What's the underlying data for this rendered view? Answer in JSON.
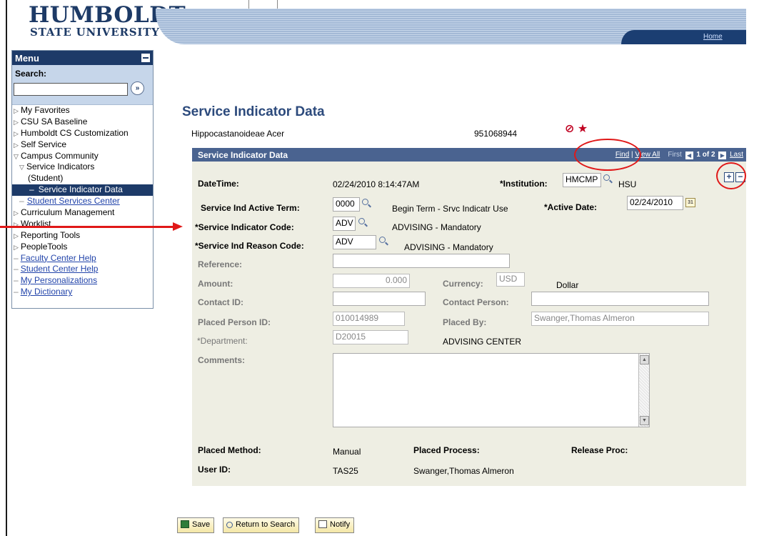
{
  "header": {
    "logo_line1": "HUMBOLDT",
    "logo_line2": "STATE UNIVERSITY",
    "home_link": "Home"
  },
  "sidebar": {
    "title": "Menu",
    "search_label": "Search:",
    "search_value": "",
    "items": [
      {
        "label": "My Favorites",
        "type": "collapsed"
      },
      {
        "label": "CSU SA Baseline",
        "type": "collapsed"
      },
      {
        "label": "Humboldt CS Customization",
        "type": "collapsed"
      },
      {
        "label": "Self Service",
        "type": "collapsed"
      },
      {
        "label": "Campus Community",
        "type": "expanded"
      },
      {
        "label": "Service Indicators",
        "type": "expanded-sub"
      },
      {
        "label": "(Student)",
        "type": "sub-continuation"
      },
      {
        "label": "Service Indicator Data",
        "type": "selected"
      },
      {
        "label": "Student Services Center",
        "type": "sub-link"
      },
      {
        "label": "Curriculum Management",
        "type": "collapsed"
      },
      {
        "label": "Worklist",
        "type": "collapsed"
      },
      {
        "label": "Reporting Tools",
        "type": "collapsed"
      },
      {
        "label": "PeopleTools",
        "type": "collapsed"
      },
      {
        "label": "Faculty Center Help",
        "type": "link"
      },
      {
        "label": "Student Center Help",
        "type": "link"
      },
      {
        "label": "My Personalizations",
        "type": "link"
      },
      {
        "label": "My Dictionary",
        "type": "link"
      }
    ]
  },
  "page": {
    "title": "Service Indicator Data",
    "person_name": "Hippocastanoideae Acer",
    "person_id": "951068944",
    "indicator_icons": "⊘ ★"
  },
  "panel": {
    "title": "Service Indicator Data",
    "nav_find": "Find",
    "nav_view_all": "View All",
    "nav_first": "First",
    "nav_position": "1 of 2",
    "nav_last": "Last",
    "datetime_label": "DateTime:",
    "datetime_value": "02/24/2010  8:14:47AM",
    "institution_label": "*Institution:",
    "institution_value": "HMCMP",
    "institution_desc": "HSU",
    "active_term_label": "Service Ind Active Term:",
    "active_term_value": "0000",
    "active_term_desc": "Begin Term - Srvc Indicatr Use",
    "active_date_label": "*Active Date:",
    "active_date_value": "02/24/2010",
    "indicator_code_label": "*Service Indicator Code:",
    "indicator_code_value": "ADV",
    "indicator_code_desc": "ADVISING - Mandatory",
    "reason_code_label": "*Service Ind Reason Code:",
    "reason_code_value": "ADV",
    "reason_code_desc": "ADVISING - Mandatory",
    "reference_label": "Reference:",
    "reference_value": "",
    "amount_label": "Amount:",
    "amount_value": "0.000",
    "currency_label": "Currency:",
    "currency_value": "USD",
    "currency_desc": "Dollar",
    "contact_id_label": "Contact ID:",
    "contact_id_value": "",
    "contact_person_label": "Contact Person:",
    "contact_person_value": "",
    "placed_person_label": "Placed Person ID:",
    "placed_person_value": "010014989",
    "placed_by_label": "Placed By:",
    "placed_by_value": "Swanger,Thomas Almeron",
    "department_label": "*Department:",
    "department_value": "D20015",
    "department_desc": "ADVISING CENTER",
    "comments_label": "Comments:",
    "comments_value": "",
    "placed_method_label": "Placed Method:",
    "placed_method_value": "Manual",
    "placed_process_label": "Placed Process:",
    "release_proc_label": "Release Proc:",
    "user_id_label": "User ID:",
    "user_id_value": "TAS25",
    "user_name_value": "Swanger,Thomas Almeron"
  },
  "buttons": {
    "save": "Save",
    "return_to_search": "Return to Search",
    "notify": "Notify"
  },
  "colors": {
    "brand_navy": "#1d3a68",
    "panel_header": "#4a6390",
    "panel_bg": "#eeeee3",
    "annotation_red": "#e01818"
  }
}
